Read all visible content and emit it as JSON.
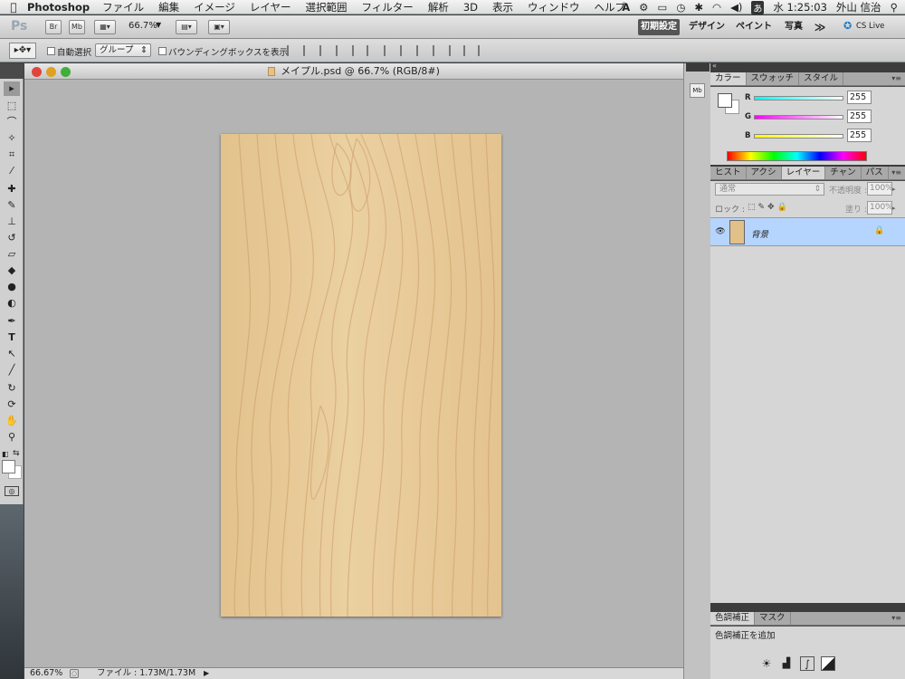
{
  "menubar": {
    "app_name": "Photoshop",
    "items": [
      "ファイル",
      "編集",
      "イメージ",
      "レイヤー",
      "選択範囲",
      "フィルター",
      "解析",
      "3D",
      "表示",
      "ウィンドウ",
      "ヘルプ"
    ],
    "clock": "水 1:25:03",
    "user": "外山 信治"
  },
  "appbar": {
    "ps_label": "Ps",
    "br_label": "Br",
    "mb_label": "Mb",
    "zoom": "66.7%",
    "workspaces": [
      "初期設定",
      "デザイン",
      "ペイント",
      "写真"
    ],
    "more": "≫",
    "cs_live": "CS Live"
  },
  "options": {
    "auto_select_label": "自動選択 :",
    "auto_select_value": "グループ",
    "bbox_label": "バウンディングボックスを表示"
  },
  "document": {
    "title": "メイプル.psd @ 66.7% (RGB/8#)",
    "zoom": "66.67%",
    "file_info": "ファイル : 1.73M/1.73M"
  },
  "color_panel": {
    "tabs": [
      "カラー",
      "スウォッチ",
      "スタイル"
    ],
    "channels": [
      {
        "label": "R",
        "value": "255"
      },
      {
        "label": "G",
        "value": "255"
      },
      {
        "label": "B",
        "value": "255"
      }
    ]
  },
  "layers_panel": {
    "tabs": [
      "ヒスト",
      "アクシ",
      "レイヤー",
      "チャン",
      "パス"
    ],
    "blend_mode": "通常",
    "opacity_label": "不透明度 :",
    "opacity_value": "100%",
    "lock_label": "ロック :",
    "fill_label": "塗り :",
    "fill_value": "100%",
    "layers": [
      {
        "name": "背景"
      }
    ]
  },
  "adjustments_panel": {
    "tabs": [
      "色調補正",
      "マスク"
    ],
    "title": "色調補正を追加"
  },
  "colors": {
    "selection_blue": "#b5d5ff",
    "wood_light": "#e7c995",
    "wood_grain": "#c99a66"
  }
}
